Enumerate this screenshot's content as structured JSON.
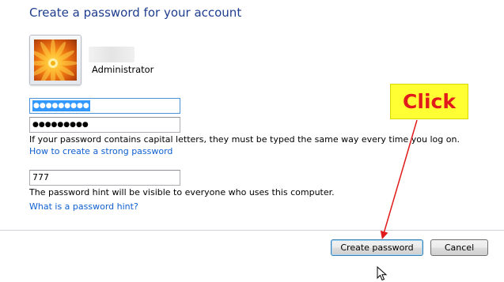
{
  "page": {
    "title": "Create a password for your account"
  },
  "account": {
    "username": "Administrator"
  },
  "form": {
    "password_mask": "●●●●●●●●●",
    "confirm_mask": "●●●●●●●●●",
    "capital_note": "If your password contains capital letters, they must be typed the same way every time you log on.",
    "strong_password_link": "How to create a strong password",
    "hint_value": "777",
    "hint_note": "The password hint will be visible to everyone who uses this computer.",
    "hint_link": "What is a password hint?"
  },
  "buttons": {
    "create": "Create password",
    "cancel": "Cancel"
  },
  "annotation": {
    "callout_text": "Click",
    "callout_bg": "#ffff33",
    "callout_text_color": "#e11b1b",
    "arrow_color": "#e11b1b"
  },
  "colors": {
    "title": "#1e3d8f",
    "link": "#0f5fd1",
    "selection": "#3399ff"
  }
}
